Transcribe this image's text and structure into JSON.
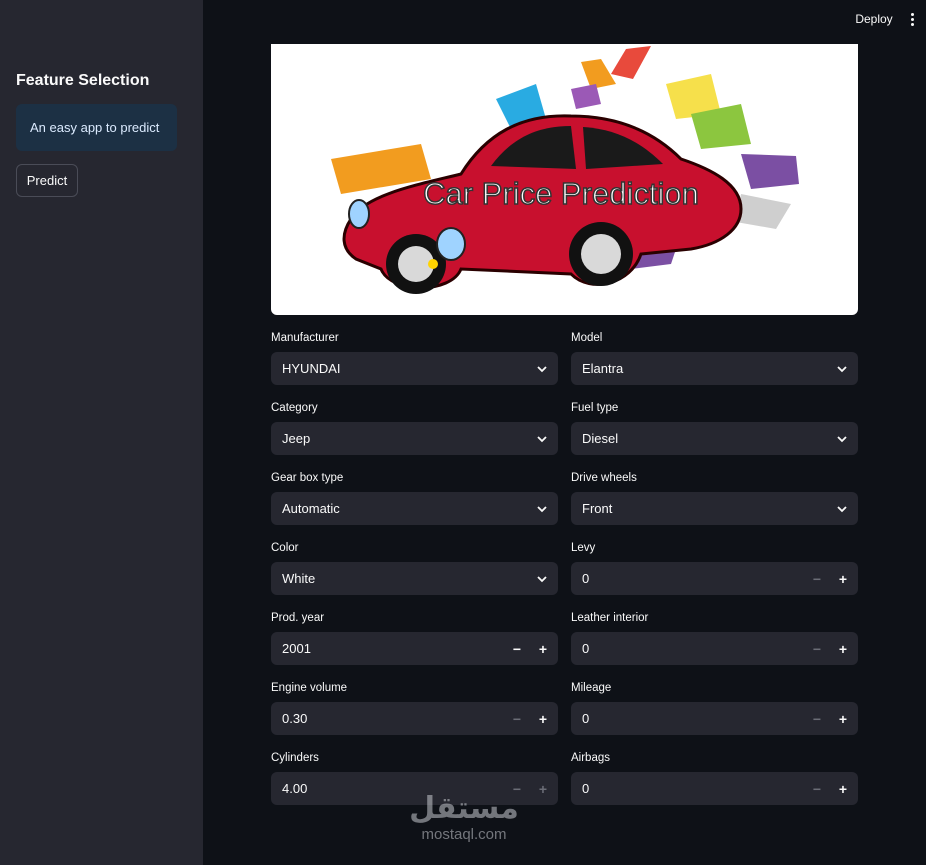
{
  "sidebar": {
    "title": "Feature Selection",
    "info": "An easy app to predict",
    "button": "Predict"
  },
  "topbar": {
    "deploy": "Deploy",
    "menu_icon": "kebab-menu-icon"
  },
  "banner": {
    "title": "Car Price Prediction",
    "car_color": "#c8102e"
  },
  "fields": {
    "manufacturer": {
      "label": "Manufacturer",
      "value": "HYUNDAI"
    },
    "model": {
      "label": "Model",
      "value": "Elantra"
    },
    "category": {
      "label": "Category",
      "value": "Jeep"
    },
    "fuel_type": {
      "label": "Fuel type",
      "value": "Diesel"
    },
    "gear_box_type": {
      "label": "Gear box type",
      "value": "Automatic"
    },
    "drive_wheels": {
      "label": "Drive wheels",
      "value": "Front"
    },
    "color": {
      "label": "Color",
      "value": "White"
    },
    "levy": {
      "label": "Levy",
      "value": "0"
    },
    "prod_year": {
      "label": "Prod. year",
      "value": "2001"
    },
    "leather_interior": {
      "label": "Leather interior",
      "value": "0"
    },
    "engine_volume": {
      "label": "Engine volume",
      "value": "0.30"
    },
    "mileage": {
      "label": "Mileage",
      "value": "0"
    },
    "cylinders": {
      "label": "Cylinders",
      "value": "4.00"
    },
    "airbags": {
      "label": "Airbags",
      "value": "0"
    }
  },
  "stepper": {
    "minus": "−",
    "plus": "+"
  },
  "watermark": {
    "arabic": "مستقل",
    "latin": "mostaql.com"
  }
}
